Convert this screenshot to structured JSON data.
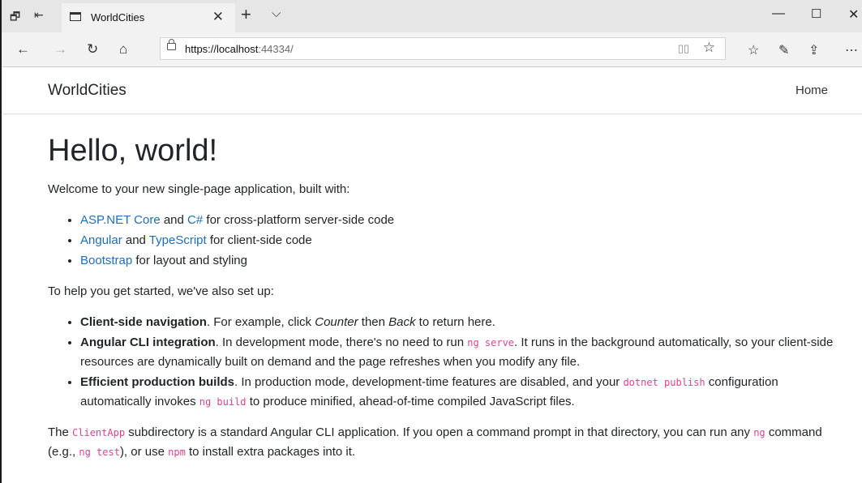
{
  "browser": {
    "tab_title": "WorldCities",
    "url_host": "https://localhost",
    "url_rest": ":44334/"
  },
  "app": {
    "brand": "WorldCities",
    "nav_home": "Home"
  },
  "page": {
    "heading": "Hello, world!",
    "intro": "Welcome to your new single-page application, built with:",
    "built_with": [
      {
        "link1": "ASP.NET Core",
        "mid": " and ",
        "link2": "C#",
        "tail": " for cross-platform server-side code"
      },
      {
        "link1": "Angular",
        "mid": " and ",
        "link2": "TypeScript",
        "tail": " for client-side code"
      },
      {
        "link1": "Bootstrap",
        "tail": " for layout and styling"
      }
    ],
    "setup_intro": "To help you get started, we've also set up:",
    "features": [
      {
        "title": "Client-side navigation",
        "t1": ". For example, click ",
        "em1": "Counter",
        "t2": " then ",
        "em2": "Back",
        "t3": " to return here."
      },
      {
        "title": "Angular CLI integration",
        "t1": ". In development mode, there's no need to run ",
        "code1": "ng serve",
        "t2": ". It runs in the background automatically, so your client-side resources are dynamically built on demand and the page refreshes when you modify any file."
      },
      {
        "title": "Efficient production builds",
        "t1": ". In production mode, development-time features are disabled, and your ",
        "code1": "dotnet publish",
        "t2": " configuration automatically invokes ",
        "code2": "ng build",
        "t3": " to produce minified, ahead-of-time compiled JavaScript files."
      }
    ],
    "footer": {
      "t1": "The ",
      "code1": "ClientApp",
      "t2": " subdirectory is a standard Angular CLI application. If you open a command prompt in that directory, you can run any ",
      "code2": "ng",
      "t3": " command (e.g., ",
      "code3": "ng test",
      "t4": "), or use ",
      "code4": "npm",
      "t5": " to install extra packages into it."
    }
  }
}
